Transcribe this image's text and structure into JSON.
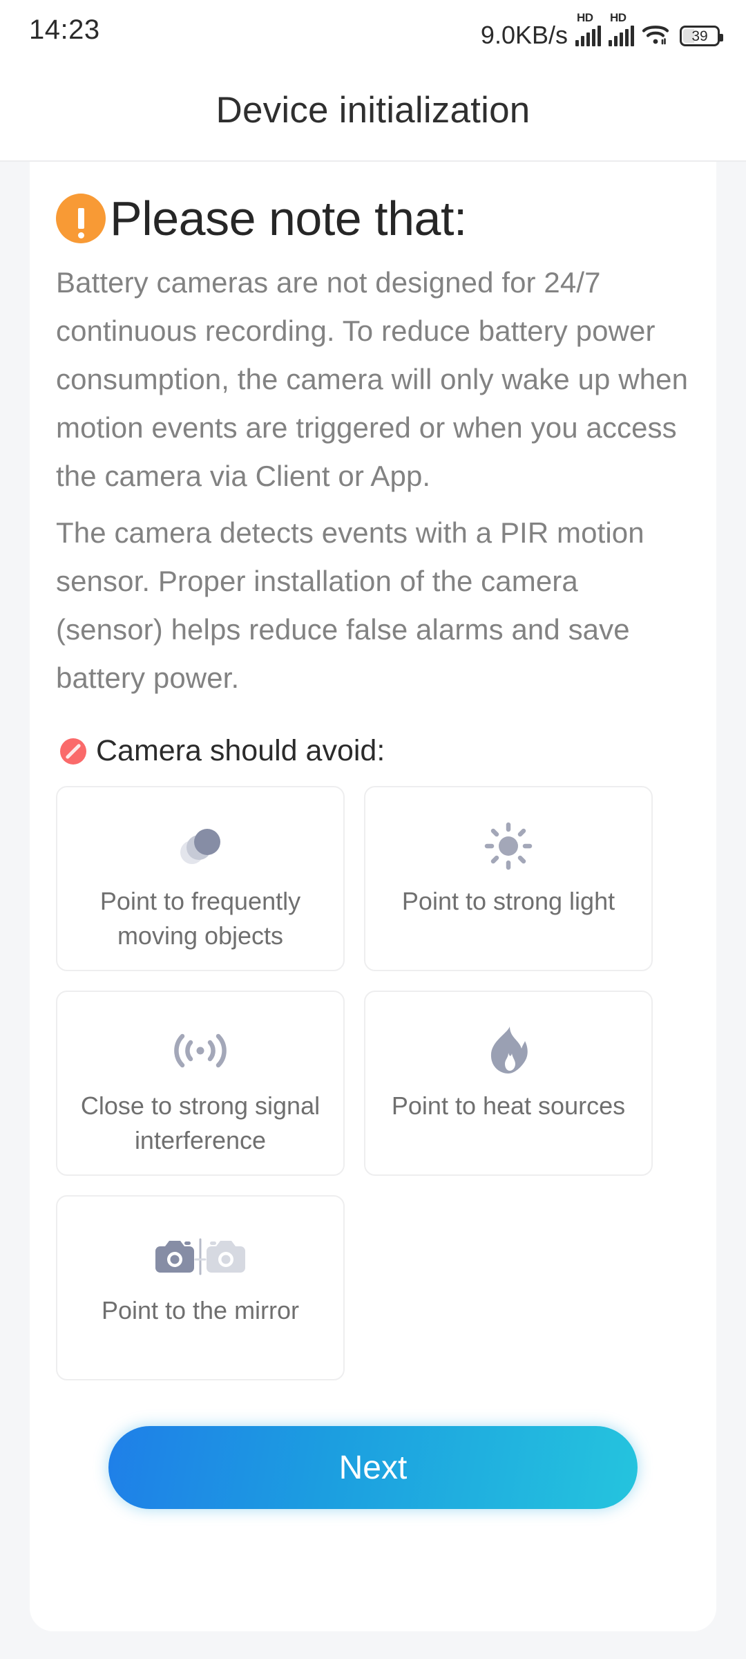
{
  "status_bar": {
    "time": "14:23",
    "net_speed": "9.0KB/s",
    "signal_1_label": "HD",
    "signal_2_label": "HD",
    "wifi_icon": "wifi-icon",
    "battery_level": "39"
  },
  "header": {
    "title": "Device initialization"
  },
  "note": {
    "icon": "warning-exclamation-icon",
    "title": "Please note that:",
    "paragraphs": [
      "Battery cameras are not designed for 24/7 continuous recording. To reduce battery power consumption, the camera will only wake up when motion events are triggered or when you access the camera via Client or App.",
      "The camera detects events with a PIR motion sensor. Proper installation of the camera (sensor) helps reduce false alarms and save battery power."
    ]
  },
  "avoid_section": {
    "icon": "prohibition-icon",
    "title": "Camera should avoid:",
    "cards": [
      {
        "icon": "moving-objects-icon",
        "label": "Point to frequently moving objects"
      },
      {
        "icon": "sun-icon",
        "label": "Point to strong light"
      },
      {
        "icon": "signal-waves-icon",
        "label": "Close to strong signal interference"
      },
      {
        "icon": "flame-icon",
        "label": "Point to heat sources"
      },
      {
        "icon": "mirror-camera-icon",
        "label": "Point to the mirror"
      }
    ]
  },
  "footer": {
    "next_label": "Next"
  },
  "colors": {
    "warning_orange": "#f89a35",
    "prohibition_red": "#fa6a6a",
    "icon_gray": "#a3a7b8",
    "button_gradient_start": "#1f7fe8",
    "button_gradient_end": "#25c4de",
    "page_background": "#f5f6f8",
    "panel_background": "#ffffff"
  }
}
